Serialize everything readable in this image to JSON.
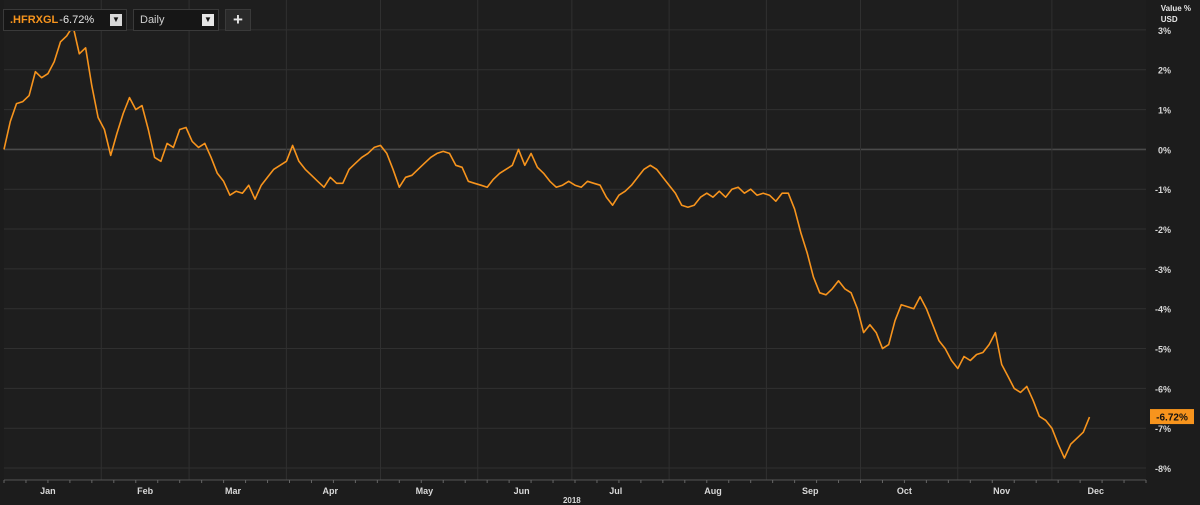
{
  "toolbar": {
    "symbol": ".HFRXGL",
    "change": "-6.72%",
    "period": "Daily",
    "add_label": "+"
  },
  "axis_units": {
    "line1": "Value %",
    "line2": "USD"
  },
  "colors": {
    "line": "#f7941d",
    "background": "#1c1c1c",
    "grid": "#303030",
    "zero_line": "#4a4a4a"
  },
  "chart_data": {
    "type": "line",
    "title": "",
    "xlabel": "2018",
    "ylabel": "Value %",
    "ylim": [
      -8.3,
      3.6
    ],
    "xlim": [
      "2018-01-01",
      "2018-12-31"
    ],
    "yticks": [
      3,
      2,
      1,
      0,
      -1,
      -2,
      -3,
      -4,
      -5,
      -6,
      -7,
      -8
    ],
    "ytick_labels": [
      "3%",
      "2%",
      "1%",
      "0%",
      "-1%",
      "-2%",
      "-3%",
      "-4%",
      "-5%",
      "-6%",
      "-7%",
      "-8%"
    ],
    "xticks": [
      "2018-01-15",
      "2018-02-15",
      "2018-03-15",
      "2018-04-15",
      "2018-05-15",
      "2018-06-15",
      "2018-07-15",
      "2018-08-15",
      "2018-09-15",
      "2018-10-15",
      "2018-11-15",
      "2018-12-15"
    ],
    "xtick_labels": [
      "Jan",
      "Feb",
      "Mar",
      "Apr",
      "May",
      "Jun",
      "Jul",
      "Aug",
      "Sep",
      "Oct",
      "Nov",
      "Dec"
    ],
    "last_value_label": "-6.72%",
    "grid": true,
    "series": [
      {
        "name": ".HFRXGL",
        "points": [
          [
            "2018-01-01",
            0.0
          ],
          [
            "2018-01-03",
            0.7
          ],
          [
            "2018-01-05",
            1.15
          ],
          [
            "2018-01-07",
            1.2
          ],
          [
            "2018-01-09",
            1.35
          ],
          [
            "2018-01-11",
            1.95
          ],
          [
            "2018-01-13",
            1.8
          ],
          [
            "2018-01-15",
            1.9
          ],
          [
            "2018-01-17",
            2.2
          ],
          [
            "2018-01-19",
            2.7
          ],
          [
            "2018-01-21",
            2.85
          ],
          [
            "2018-01-23",
            3.1
          ],
          [
            "2018-01-25",
            2.4
          ],
          [
            "2018-01-27",
            2.55
          ],
          [
            "2018-01-29",
            1.6
          ],
          [
            "2018-01-31",
            0.8
          ],
          [
            "2018-02-02",
            0.5
          ],
          [
            "2018-02-04",
            -0.15
          ],
          [
            "2018-02-06",
            0.4
          ],
          [
            "2018-02-08",
            0.9
          ],
          [
            "2018-02-10",
            1.3
          ],
          [
            "2018-02-12",
            1.0
          ],
          [
            "2018-02-14",
            1.1
          ],
          [
            "2018-02-16",
            0.5
          ],
          [
            "2018-02-18",
            -0.2
          ],
          [
            "2018-02-20",
            -0.3
          ],
          [
            "2018-02-22",
            0.15
          ],
          [
            "2018-02-24",
            0.05
          ],
          [
            "2018-02-26",
            0.5
          ],
          [
            "2018-02-28",
            0.55
          ],
          [
            "2018-03-02",
            0.2
          ],
          [
            "2018-03-04",
            0.05
          ],
          [
            "2018-03-06",
            0.15
          ],
          [
            "2018-03-08",
            -0.2
          ],
          [
            "2018-03-10",
            -0.6
          ],
          [
            "2018-03-12",
            -0.8
          ],
          [
            "2018-03-14",
            -1.15
          ],
          [
            "2018-03-16",
            -1.05
          ],
          [
            "2018-03-18",
            -1.1
          ],
          [
            "2018-03-20",
            -0.9
          ],
          [
            "2018-03-22",
            -1.25
          ],
          [
            "2018-03-24",
            -0.9
          ],
          [
            "2018-03-26",
            -0.7
          ],
          [
            "2018-03-28",
            -0.5
          ],
          [
            "2018-04-01",
            -0.3
          ],
          [
            "2018-04-03",
            0.1
          ],
          [
            "2018-04-05",
            -0.3
          ],
          [
            "2018-04-07",
            -0.5
          ],
          [
            "2018-04-09",
            -0.65
          ],
          [
            "2018-04-11",
            -0.8
          ],
          [
            "2018-04-13",
            -0.95
          ],
          [
            "2018-04-15",
            -0.7
          ],
          [
            "2018-04-17",
            -0.85
          ],
          [
            "2018-04-19",
            -0.85
          ],
          [
            "2018-04-21",
            -0.5
          ],
          [
            "2018-04-23",
            -0.35
          ],
          [
            "2018-04-25",
            -0.2
          ],
          [
            "2018-04-27",
            -0.1
          ],
          [
            "2018-04-29",
            0.05
          ],
          [
            "2018-05-01",
            0.1
          ],
          [
            "2018-05-03",
            -0.1
          ],
          [
            "2018-05-05",
            -0.5
          ],
          [
            "2018-05-07",
            -0.95
          ],
          [
            "2018-05-09",
            -0.7
          ],
          [
            "2018-05-11",
            -0.65
          ],
          [
            "2018-05-13",
            -0.5
          ],
          [
            "2018-05-15",
            -0.35
          ],
          [
            "2018-05-17",
            -0.2
          ],
          [
            "2018-05-19",
            -0.1
          ],
          [
            "2018-05-21",
            -0.05
          ],
          [
            "2018-05-23",
            -0.1
          ],
          [
            "2018-05-25",
            -0.4
          ],
          [
            "2018-05-27",
            -0.45
          ],
          [
            "2018-05-29",
            -0.8
          ],
          [
            "2018-05-31",
            -0.85
          ],
          [
            "2018-06-02",
            -0.9
          ],
          [
            "2018-06-04",
            -0.95
          ],
          [
            "2018-06-06",
            -0.75
          ],
          [
            "2018-06-08",
            -0.6
          ],
          [
            "2018-06-10",
            -0.5
          ],
          [
            "2018-06-12",
            -0.4
          ],
          [
            "2018-06-14",
            0.0
          ],
          [
            "2018-06-16",
            -0.4
          ],
          [
            "2018-06-18",
            -0.1
          ],
          [
            "2018-06-20",
            -0.45
          ],
          [
            "2018-06-22",
            -0.6
          ],
          [
            "2018-06-24",
            -0.8
          ],
          [
            "2018-06-26",
            -0.95
          ],
          [
            "2018-06-28",
            -0.9
          ],
          [
            "2018-06-30",
            -0.8
          ],
          [
            "2018-07-02",
            -0.9
          ],
          [
            "2018-07-04",
            -0.95
          ],
          [
            "2018-07-06",
            -0.8
          ],
          [
            "2018-07-08",
            -0.85
          ],
          [
            "2018-07-10",
            -0.9
          ],
          [
            "2018-07-12",
            -1.2
          ],
          [
            "2018-07-14",
            -1.4
          ],
          [
            "2018-07-16",
            -1.15
          ],
          [
            "2018-07-18",
            -1.05
          ],
          [
            "2018-07-20",
            -0.9
          ],
          [
            "2018-07-22",
            -0.7
          ],
          [
            "2018-07-24",
            -0.5
          ],
          [
            "2018-07-26",
            -0.4
          ],
          [
            "2018-07-28",
            -0.5
          ],
          [
            "2018-07-30",
            -0.7
          ],
          [
            "2018-08-01",
            -0.9
          ],
          [
            "2018-08-03",
            -1.1
          ],
          [
            "2018-08-05",
            -1.4
          ],
          [
            "2018-08-07",
            -1.45
          ],
          [
            "2018-08-09",
            -1.4
          ],
          [
            "2018-08-11",
            -1.2
          ],
          [
            "2018-08-13",
            -1.1
          ],
          [
            "2018-08-15",
            -1.2
          ],
          [
            "2018-08-17",
            -1.05
          ],
          [
            "2018-08-19",
            -1.2
          ],
          [
            "2018-08-21",
            -1.0
          ],
          [
            "2018-08-23",
            -0.95
          ],
          [
            "2018-08-25",
            -1.1
          ],
          [
            "2018-08-27",
            -1.0
          ],
          [
            "2018-08-29",
            -1.15
          ],
          [
            "2018-08-31",
            -1.1
          ],
          [
            "2018-09-02",
            -1.15
          ],
          [
            "2018-09-04",
            -1.3
          ],
          [
            "2018-09-06",
            -1.1
          ],
          [
            "2018-09-08",
            -1.1
          ],
          [
            "2018-09-10",
            -1.5
          ],
          [
            "2018-09-12",
            -2.1
          ],
          [
            "2018-09-14",
            -2.6
          ],
          [
            "2018-09-16",
            -3.2
          ],
          [
            "2018-09-18",
            -3.6
          ],
          [
            "2018-09-20",
            -3.65
          ],
          [
            "2018-09-22",
            -3.5
          ],
          [
            "2018-09-24",
            -3.3
          ],
          [
            "2018-09-26",
            -3.5
          ],
          [
            "2018-09-28",
            -3.6
          ],
          [
            "2018-09-30",
            -4.0
          ],
          [
            "2018-10-02",
            -4.6
          ],
          [
            "2018-10-04",
            -4.4
          ],
          [
            "2018-10-06",
            -4.6
          ],
          [
            "2018-10-08",
            -5.0
          ],
          [
            "2018-10-10",
            -4.9
          ],
          [
            "2018-10-12",
            -4.3
          ],
          [
            "2018-10-14",
            -3.9
          ],
          [
            "2018-10-16",
            -3.95
          ],
          [
            "2018-10-18",
            -4.0
          ],
          [
            "2018-10-20",
            -3.7
          ],
          [
            "2018-10-22",
            -4.0
          ],
          [
            "2018-10-24",
            -4.4
          ],
          [
            "2018-10-26",
            -4.8
          ],
          [
            "2018-10-28",
            -5.0
          ],
          [
            "2018-10-30",
            -5.3
          ],
          [
            "2018-11-01",
            -5.5
          ],
          [
            "2018-11-03",
            -5.2
          ],
          [
            "2018-11-05",
            -5.3
          ],
          [
            "2018-11-07",
            -5.15
          ],
          [
            "2018-11-09",
            -5.1
          ],
          [
            "2018-11-11",
            -4.9
          ],
          [
            "2018-11-13",
            -4.6
          ],
          [
            "2018-11-15",
            -5.4
          ],
          [
            "2018-11-17",
            -5.7
          ],
          [
            "2018-11-19",
            -6.0
          ],
          [
            "2018-11-21",
            -6.1
          ],
          [
            "2018-11-23",
            -5.95
          ],
          [
            "2018-11-25",
            -6.3
          ],
          [
            "2018-11-27",
            -6.7
          ],
          [
            "2018-11-29",
            -6.8
          ],
          [
            "2018-12-01",
            -7.0
          ],
          [
            "2018-12-03",
            -7.4
          ],
          [
            "2018-12-05",
            -7.75
          ],
          [
            "2018-12-07",
            -7.4
          ],
          [
            "2018-12-09",
            -7.25
          ],
          [
            "2018-12-11",
            -7.1
          ],
          [
            "2018-12-13",
            -6.72
          ]
        ]
      }
    ]
  }
}
